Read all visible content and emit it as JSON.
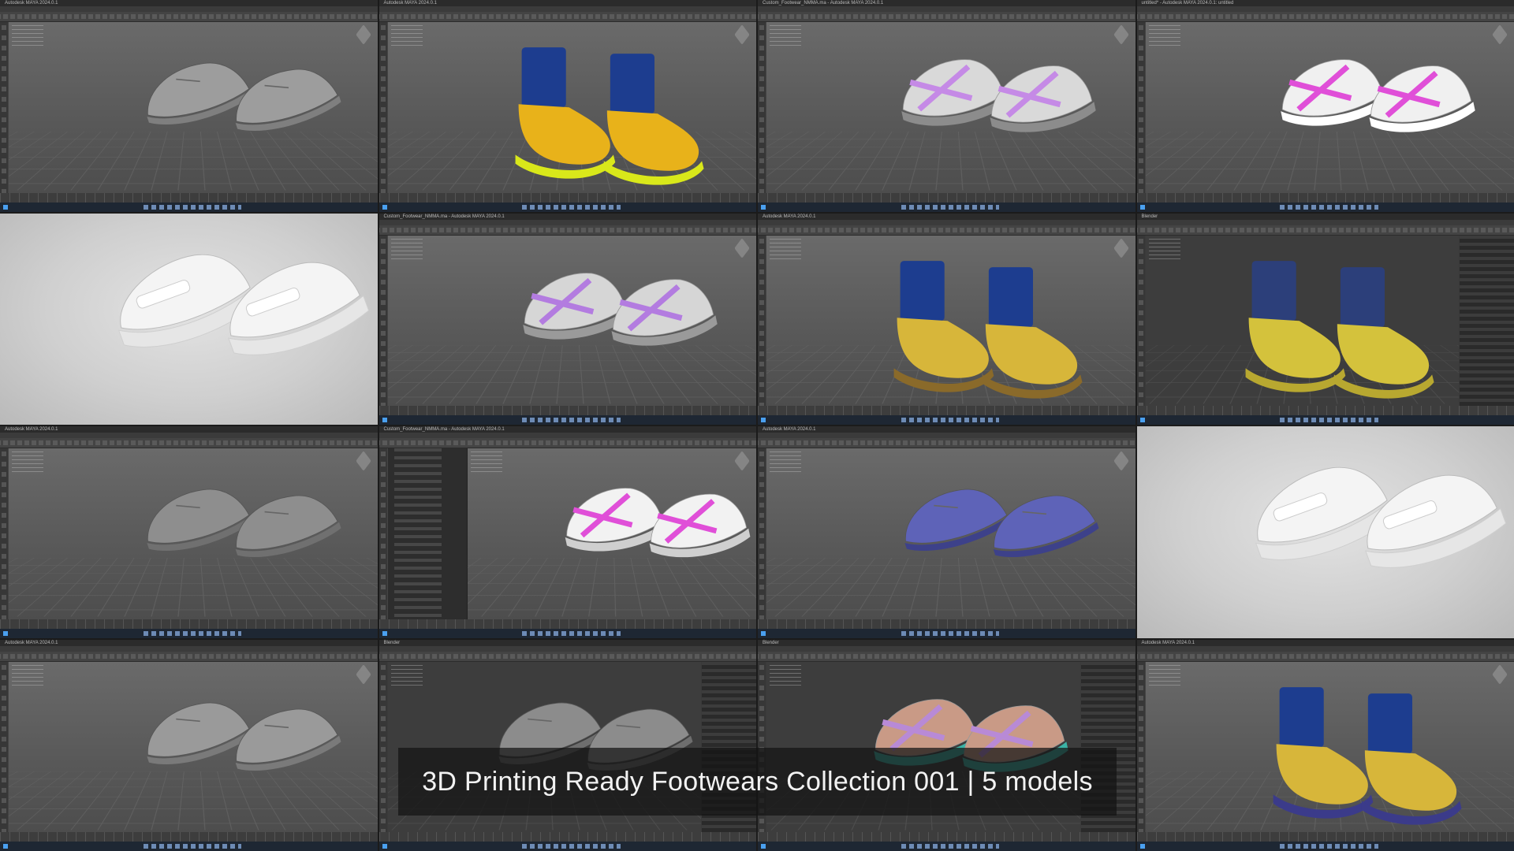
{
  "caption": "3D Printing Ready Footwears Collection 001 | 5 models",
  "tiles": [
    {
      "kind": "maya",
      "model": "oxford",
      "title": "Autodesk MAYA 2024.0.1",
      "colors": {
        "upper": "#9d9d9d",
        "sole": "#7f7f7f"
      }
    },
    {
      "kind": "maya",
      "model": "boot-closeup",
      "title": "Autodesk MAYA 2024.0.1",
      "colors": {
        "upper": "#e8b21a",
        "top": "#1d3d8f",
        "sole": "#d9e81a"
      }
    },
    {
      "kind": "maya",
      "model": "sandal",
      "title": "Custom_Footwear_NMMA.ma - Autodesk MAYA 2024.0.1",
      "colors": {
        "upper": "#d9d9d9",
        "strap": "#c58ae6",
        "sole": "#8c8c8c"
      }
    },
    {
      "kind": "maya",
      "model": "sandal-large",
      "title": "untitled* - Autodesk MAYA 2024.0.1: untitled",
      "colors": {
        "upper": "#f0f0f0",
        "strap": "#e04fd8",
        "sole": "#ffffff"
      }
    },
    {
      "kind": "render",
      "model": "loafer-front",
      "colors": {
        "upper": "#f4f4f4",
        "sole": "#e6e6e6"
      }
    },
    {
      "kind": "maya",
      "model": "sandal-small",
      "title": "Custom_Footwear_NMMA.ma - Autodesk MAYA 2024.0.1",
      "colors": {
        "upper": "#d6d6d6",
        "strap": "#b37ce0",
        "sole": "#9a9a9a"
      }
    },
    {
      "kind": "maya",
      "model": "boot-wire",
      "title": "Autodesk MAYA 2024.0.1",
      "colors": {
        "upper": "#d7b63a",
        "top": "#1d3d8f",
        "sole": "#8a6a2a"
      }
    },
    {
      "kind": "blender",
      "model": "boot-blender",
      "title": "Blender",
      "colors": {
        "upper": "#d4c23c",
        "top": "#2c3f7a",
        "sole": "#b8a830"
      }
    },
    {
      "kind": "maya",
      "model": "loafer-gray",
      "title": "Autodesk MAYA 2024.0.1",
      "colors": {
        "upper": "#8e8e8e",
        "sole": "#707070"
      }
    },
    {
      "kind": "maya-outliner",
      "model": "sandal-pink",
      "title": "Custom_Footwear_NMMA.ma - Autodesk MAYA 2024.0.1",
      "colors": {
        "upper": "#f2f2f2",
        "strap": "#e04fd8",
        "sole": "#cfcfcf"
      }
    },
    {
      "kind": "maya",
      "model": "oxford-wire",
      "title": "Autodesk MAYA 2024.0.1",
      "colors": {
        "upper": "#5e63b8",
        "sole": "#3d418a"
      }
    },
    {
      "kind": "render",
      "model": "loafer-side",
      "colors": {
        "upper": "#f4f4f4",
        "sole": "#e6e6e6"
      }
    },
    {
      "kind": "maya",
      "model": "oxford-top",
      "title": "Autodesk MAYA 2024.0.1",
      "colors": {
        "upper": "#9a9a9a",
        "sole": "#7a7a7a"
      }
    },
    {
      "kind": "blender",
      "model": "oxford-blender",
      "title": "Blender",
      "colors": {
        "upper": "#8c8c8c",
        "sole": "#6e6e6e"
      }
    },
    {
      "kind": "blender",
      "model": "sandal-color",
      "title": "Blender",
      "colors": {
        "upper": "#c99a86",
        "strap": "#b88ad6",
        "sole": "#3bb3a6"
      }
    },
    {
      "kind": "maya",
      "model": "boot-wire-2",
      "title": "Autodesk MAYA 2024.0.1",
      "colors": {
        "upper": "#d7b63a",
        "top": "#1d3d8f",
        "sole": "#3b3b8a"
      }
    }
  ]
}
